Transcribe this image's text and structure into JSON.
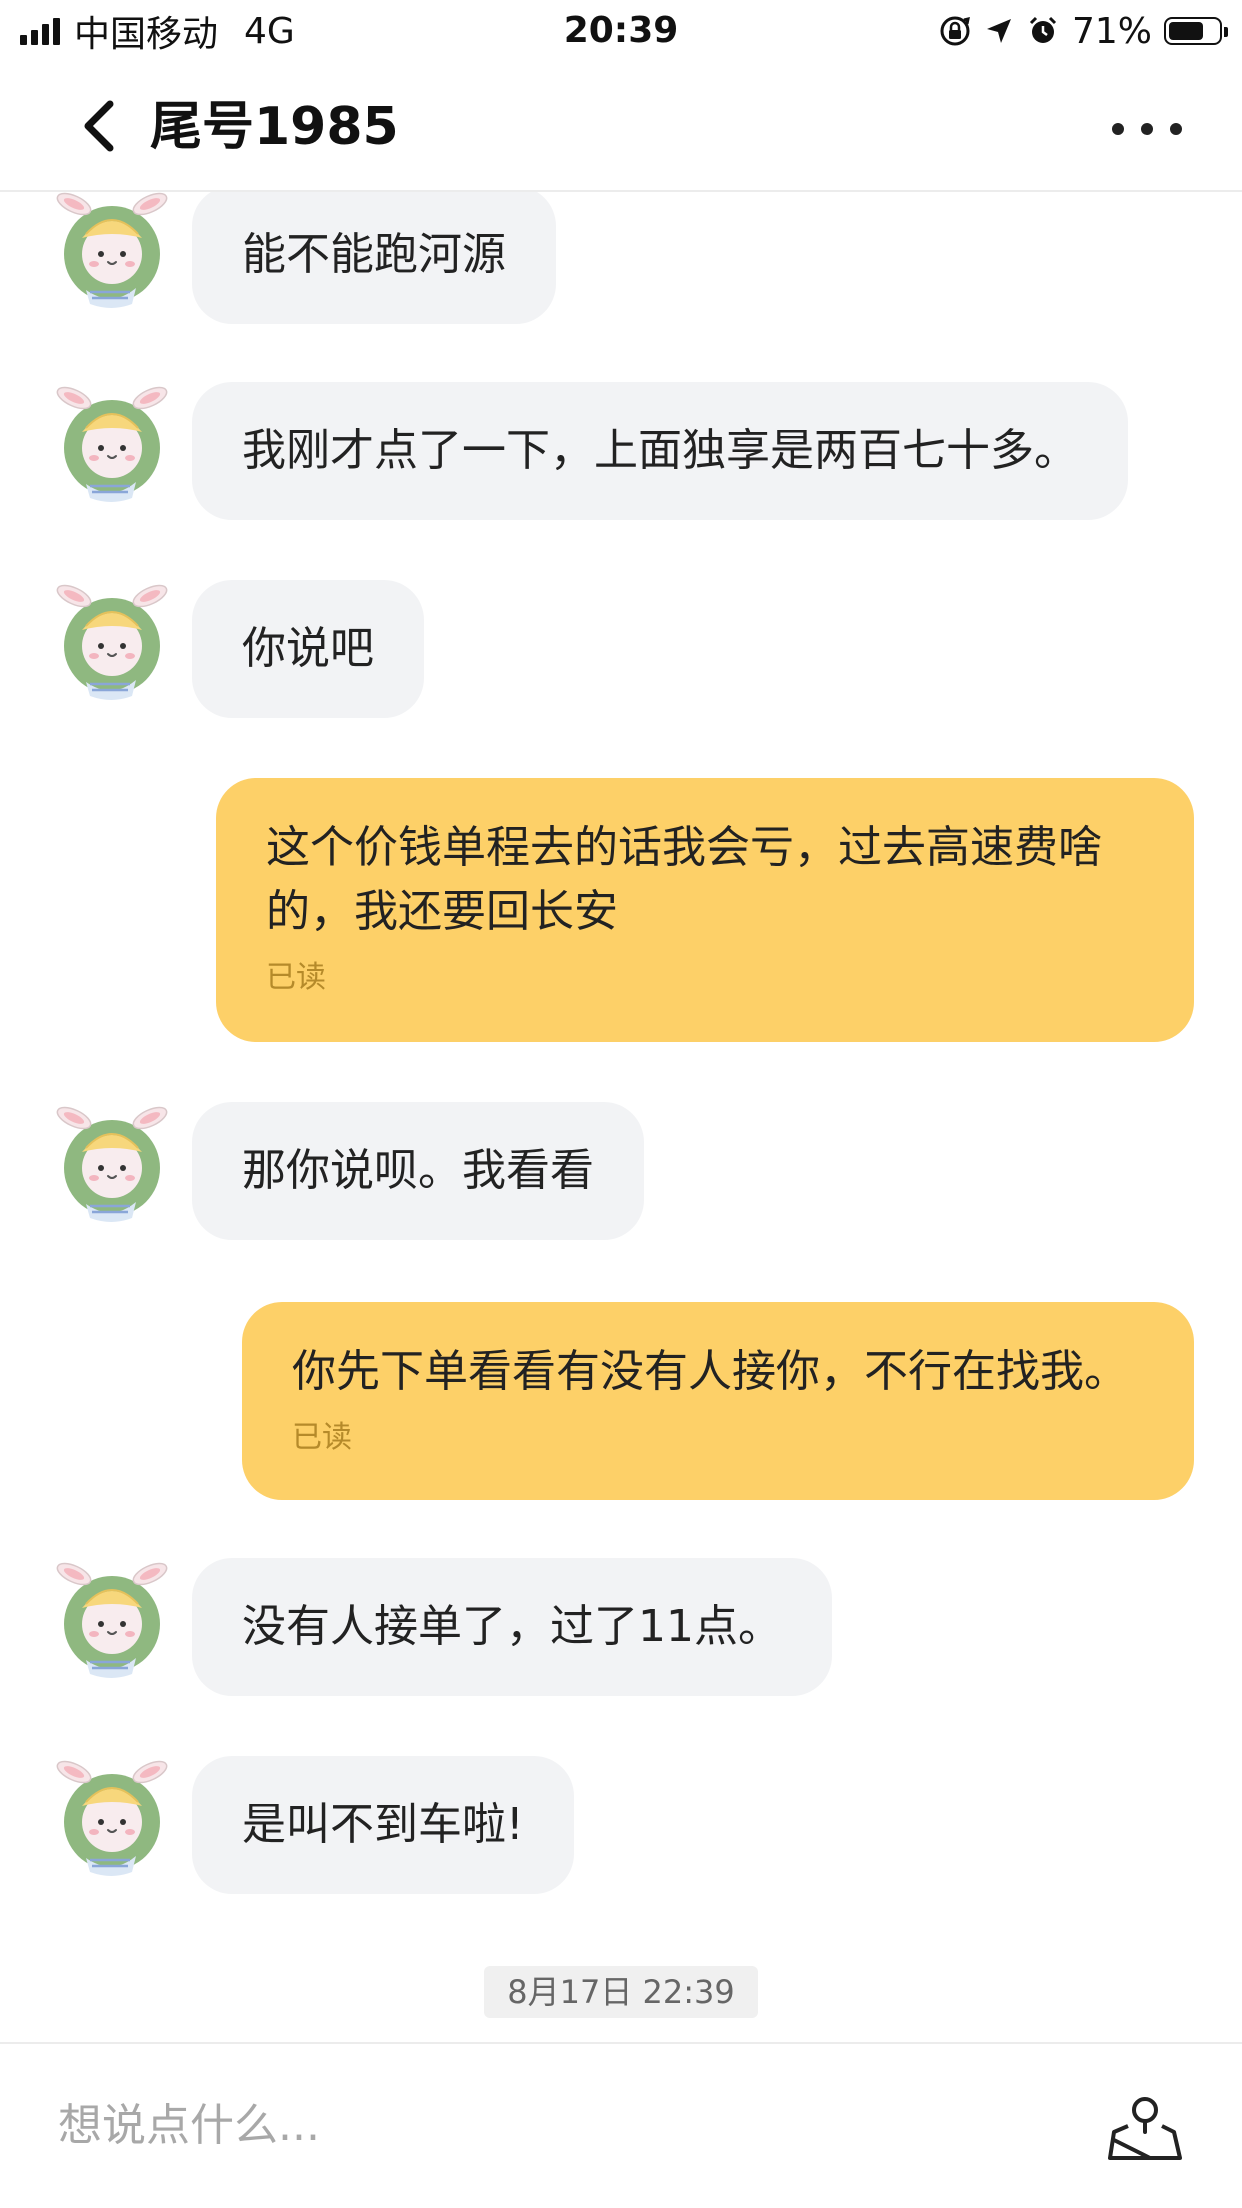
{
  "status_bar": {
    "carrier": "中国移动",
    "network": "4G",
    "time": "20:39",
    "battery": "71%",
    "battery_level": 0.71
  },
  "header": {
    "title": "尾号1985",
    "back_icon": "chevron-left-icon",
    "more_icon": "more-dots-icon"
  },
  "messages": [
    {
      "from": "other",
      "text": "能不能跑河源"
    },
    {
      "from": "other",
      "text": "我刚才点了一下，上面独享是两百七十多。"
    },
    {
      "from": "other",
      "text": "你说吧"
    },
    {
      "from": "me",
      "line1": "这个价钱单程去的话我会亏，过去高速费啥",
      "line2": "的，我还要回长安",
      "status": "已读"
    },
    {
      "from": "other",
      "text": "那你说呗。我看看"
    },
    {
      "from": "me",
      "line1": "你先下单看看有没有人接你，不行在找我。",
      "status": "已读"
    },
    {
      "from": "other",
      "text": "没有人接单了，过了11点。"
    },
    {
      "from": "other",
      "text": "是叫不到车啦!"
    }
  ],
  "timestamp": "8月17日 22:39",
  "input": {
    "placeholder": "想说点什么...",
    "location_icon": "location-share-icon"
  },
  "colors": {
    "outgoing_bubble": "#fdd068",
    "incoming_bubble": "#f2f3f5",
    "read_text": "#b58a2a"
  }
}
